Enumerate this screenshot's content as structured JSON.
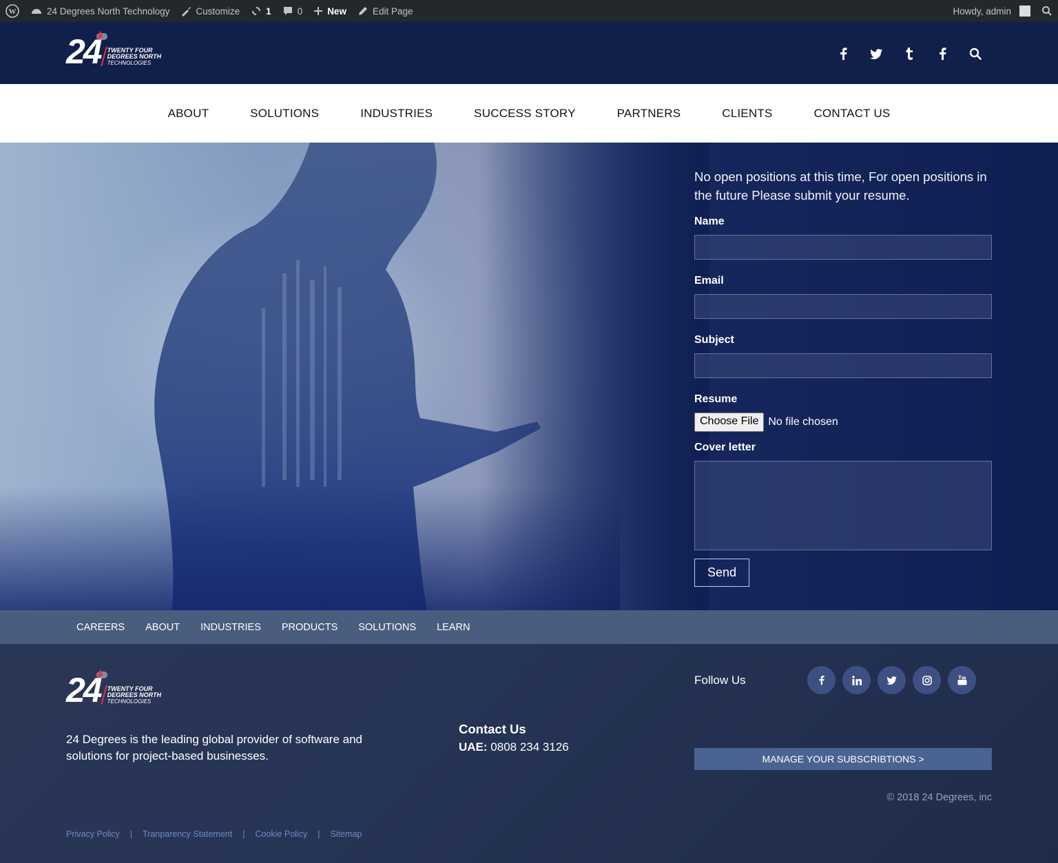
{
  "admin_bar": {
    "site_name": "24 Degrees North Technology",
    "customize": "Customize",
    "updates": "1",
    "comments": "0",
    "new": "New",
    "edit_page": "Edit Page",
    "howdy": "Howdy, admin"
  },
  "logo": {
    "number": "24",
    "line1": "TWENTY FOUR",
    "line2": "DEGREES NORTH",
    "line3": "TECHNOLOGIES"
  },
  "header_icons": [
    "facebook-icon",
    "twitter-icon",
    "tumblr-icon",
    "facebook-icon",
    "search-icon"
  ],
  "nav": [
    "ABOUT",
    "SOLUTIONS",
    "INDUSTRIES",
    "SUCCESS STORY",
    "PARTNERS",
    "CLIENTS",
    "CONTACT US"
  ],
  "form": {
    "intro": "No open positions at this time, For open positions in the future Please submit your resume.",
    "name_label": "Name",
    "email_label": "Email",
    "subject_label": "Subject",
    "resume_label": "Resume",
    "file_button": "Choose File",
    "file_status": "No file chosen",
    "cover_label": "Cover letter",
    "send": "Send"
  },
  "footer_nav": [
    "CAREERS",
    "ABOUT",
    "INDUSTRIES",
    "PRODUCTS",
    "SOLUTIONS",
    "LEARN"
  ],
  "footer": {
    "about": "24 Degrees is the leading global provider of software and solutions for project-based businesses.",
    "contact_heading": "Contact Us",
    "contact_label": "UAE:",
    "contact_phone": "0808 234 3126",
    "follow": "Follow Us",
    "socials": [
      "facebook-icon",
      "linkedin-icon",
      "twitter-icon",
      "instagram-icon",
      "youtube-icon"
    ],
    "manage": "MANAGE YOUR SUBSCRIBTIONS >",
    "copyright": "© 2018 24 Degrees, inc",
    "links": [
      "Privacy Policy",
      "Tranparency Statement",
      "Cookie Policy",
      "Sitemap"
    ]
  },
  "colors": {
    "header_bg": "#111f4b",
    "accent_red": "#e43540",
    "footer_nav_bg": "#4a5d7f",
    "manage_bg": "#4a6393",
    "link": "#6f8ac0"
  }
}
